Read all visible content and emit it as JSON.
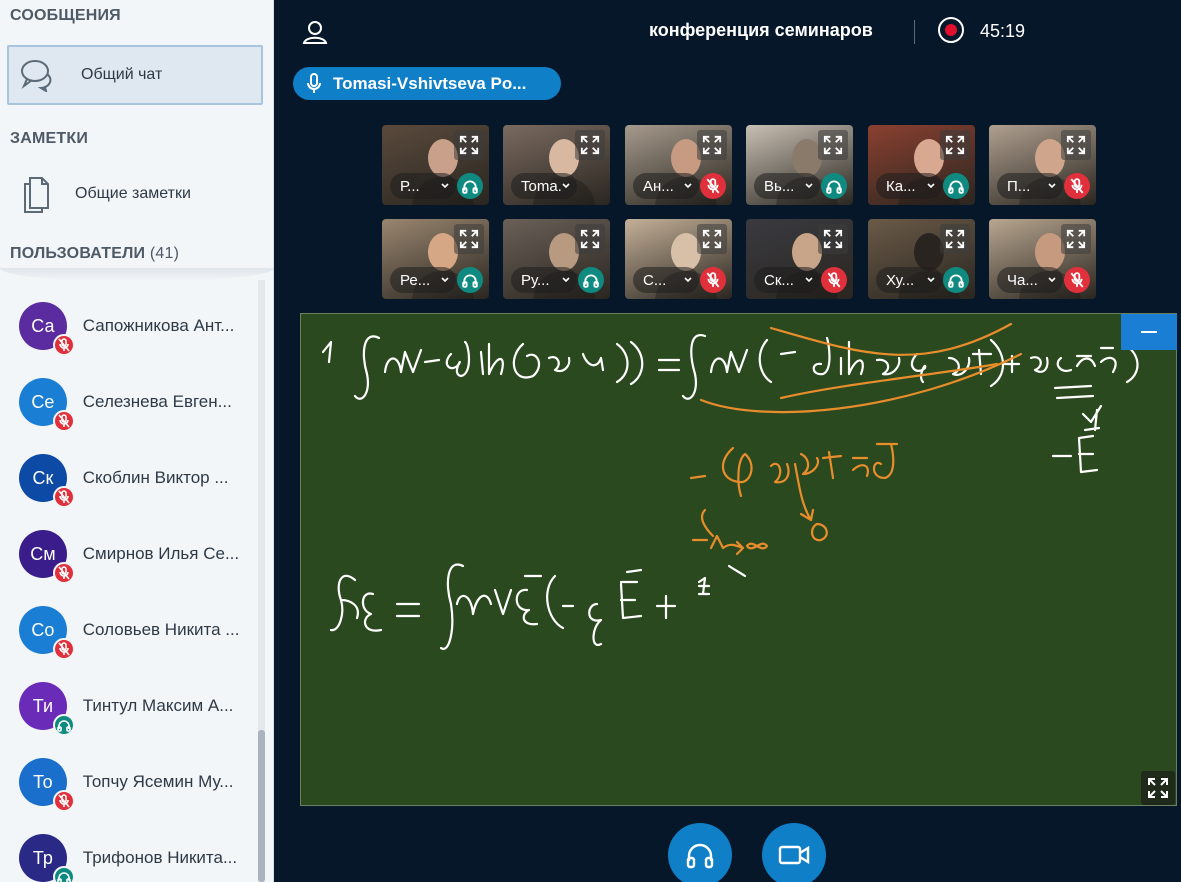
{
  "sidebar": {
    "messages_title": "СООБЩЕНИЯ",
    "public_chat_label": "Общий чат",
    "notes_title": "ЗАМЕТКИ",
    "shared_notes_label": "Общие заметки",
    "users_title": "ПОЛЬЗОВАТЕЛИ",
    "users_count": "(41)",
    "users": [
      {
        "initials": "Са",
        "name": "Сапожникова Ант...",
        "color": "#5b2ca0",
        "audio": "muted"
      },
      {
        "initials": "Се",
        "name": "Селезнева Евген...",
        "color": "#1a7fd4",
        "audio": "muted"
      },
      {
        "initials": "Ск",
        "name": "Скоблин Виктор ...",
        "color": "#0d4aa6",
        "audio": "muted"
      },
      {
        "initials": "См",
        "name": "Смирнов Илья Се...",
        "color": "#3a1d8a",
        "audio": "muted"
      },
      {
        "initials": "Со",
        "name": "Соловьев Никита ...",
        "color": "#1a7fd4",
        "audio": "muted"
      },
      {
        "initials": "Ти",
        "name": "Тинтул Максим А...",
        "color": "#6a2cb8",
        "audio": "listen"
      },
      {
        "initials": "То",
        "name": "Топчу Ясемин Му...",
        "color": "#1a6fcc",
        "audio": "muted"
      },
      {
        "initials": "Тр",
        "name": "Трифонов Никита...",
        "color": "#2a2a86",
        "audio": "listen"
      }
    ]
  },
  "header": {
    "meeting_title": "конференция семинаров",
    "recording_time": "45:19"
  },
  "talking": {
    "speaker_name": "Tomasi-Vshivtseva Po..."
  },
  "videos": [
    {
      "name": "Р...",
      "audio": "listen",
      "bg": "#5a4a3c",
      "face": "#c9a08a"
    },
    {
      "name": "Toma...",
      "audio": "none",
      "bg": "#7a6a60",
      "face": "#d8b8a0"
    },
    {
      "name": "Ан...",
      "audio": "muted",
      "bg": "#a69a8c",
      "face": "#c79a82"
    },
    {
      "name": "Вь...",
      "audio": "listen",
      "bg": "#c8c0b4",
      "face": "#8a7a6a"
    },
    {
      "name": "Ка...",
      "audio": "listen",
      "bg": "#8a4030",
      "face": "#d9a890"
    },
    {
      "name": "П...",
      "audio": "muted",
      "bg": "#b0a090",
      "face": "#cfa58c"
    },
    {
      "name": "Ре...",
      "audio": "listen",
      "bg": "#9a8670",
      "face": "#d6a784"
    },
    {
      "name": "Ру...",
      "audio": "listen",
      "bg": "#6a6058",
      "face": "#b89a80"
    },
    {
      "name": "С...",
      "audio": "muted",
      "bg": "#c4b098",
      "face": "#d8c0a8"
    },
    {
      "name": "Ск...",
      "audio": "muted",
      "bg": "#3a3a40",
      "face": "#c8a488"
    },
    {
      "name": "Ху...",
      "audio": "listen",
      "bg": "#6a5a48",
      "face": "#2a2420"
    },
    {
      "name": "Ча...",
      "audio": "muted",
      "bg": "#b8a690",
      "face": "#c69a7e"
    }
  ],
  "colors": {
    "accent": "#0f7fc7",
    "muted": "#e0303c",
    "listen": "#0f8a80",
    "board": "#2b491f",
    "record": "#e0102c"
  }
}
